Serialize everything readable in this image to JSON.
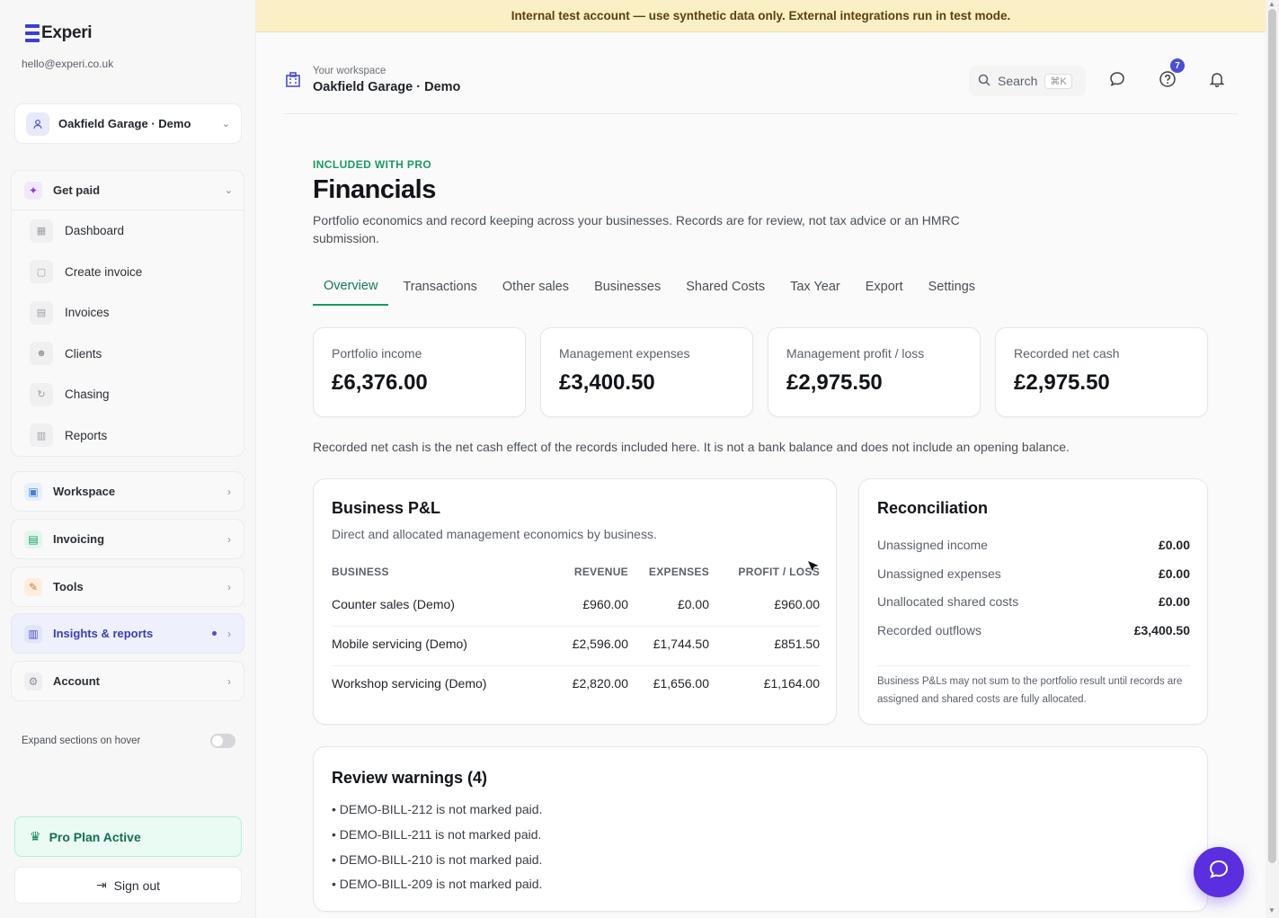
{
  "sidebar": {
    "brand": "Experi",
    "email": "hello@experi.co.uk",
    "workspace_selector": "Oakfield Garage · Demo",
    "get_paid": {
      "label": "Get paid",
      "items": [
        {
          "label": "Dashboard",
          "icon": "grid-icon"
        },
        {
          "label": "Create invoice",
          "icon": "file-plus-icon"
        },
        {
          "label": "Invoices",
          "icon": "file-icon"
        },
        {
          "label": "Clients",
          "icon": "users-icon"
        },
        {
          "label": "Chasing",
          "icon": "refresh-icon"
        },
        {
          "label": "Reports",
          "icon": "bar-chart-icon"
        }
      ]
    },
    "sections": [
      {
        "label": "Workspace",
        "icon": "calendar-icon",
        "color": "#4a80d8"
      },
      {
        "label": "Invoicing",
        "icon": "document-icon",
        "color": "#1a9a62"
      },
      {
        "label": "Tools",
        "icon": "wrench-icon",
        "color": "#e07a1f"
      },
      {
        "label": "Insights & reports",
        "icon": "chart-icon",
        "color": "#4a4fd1"
      },
      {
        "label": "Account",
        "icon": "gear-icon",
        "color": "#8b9097"
      }
    ],
    "expand_on_hover_label": "Expand sections on hover",
    "pro_plan_label": "Pro Plan Active",
    "sign_out_label": "Sign out"
  },
  "banner": "Internal test account — use synthetic data only. External integrations run in test mode.",
  "header": {
    "eyebrow": "Your workspace",
    "title": "Oakfield Garage · Demo",
    "search_label": "Search",
    "search_shortcut": "⌘K",
    "help_badge": "7"
  },
  "page": {
    "eyebrow": "INCLUDED WITH PRO",
    "title": "Financials",
    "description": "Portfolio economics and record keeping across your businesses. Records are for review, not tax advice or an HMRC submission.",
    "tabs": [
      "Overview",
      "Transactions",
      "Other sales",
      "Businesses",
      "Shared Costs",
      "Tax Year",
      "Export",
      "Settings"
    ],
    "active_tab": "Overview",
    "kpis": [
      {
        "label": "Portfolio income",
        "value": "£6,376.00"
      },
      {
        "label": "Management expenses",
        "value": "£3,400.50"
      },
      {
        "label": "Management profit / loss",
        "value": "£2,975.50"
      },
      {
        "label": "Recorded net cash",
        "value": "£2,975.50"
      }
    ],
    "net_cash_note": "Recorded net cash is the net cash effect of the records included here. It is not a bank balance and does not include an opening balance."
  },
  "pnl": {
    "title": "Business P&L",
    "subtitle": "Direct and allocated management economics by business.",
    "headers": {
      "business": "BUSINESS",
      "revenue": "REVENUE",
      "expenses": "EXPENSES",
      "profit": "PROFIT / LOSS"
    },
    "rows": [
      {
        "business": "Counter sales (Demo)",
        "revenue": "£960.00",
        "expenses": "£0.00",
        "profit": "£960.00"
      },
      {
        "business": "Mobile servicing (Demo)",
        "revenue": "£2,596.00",
        "expenses": "£1,744.50",
        "profit": "£851.50"
      },
      {
        "business": "Workshop servicing (Demo)",
        "revenue": "£2,820.00",
        "expenses": "£1,656.00",
        "profit": "£1,164.00"
      }
    ]
  },
  "reconciliation": {
    "title": "Reconciliation",
    "rows": [
      {
        "label": "Unassigned income",
        "value": "£0.00"
      },
      {
        "label": "Unassigned expenses",
        "value": "£0.00"
      },
      {
        "label": "Unallocated shared costs",
        "value": "£0.00"
      },
      {
        "label": "Recorded outflows",
        "value": "£3,400.50"
      }
    ],
    "note": "Business P&Ls may not sum to the portfolio result until records are assigned and shared costs are fully allocated."
  },
  "warnings": {
    "title": "Review warnings (4)",
    "items": [
      "• DEMO-BILL-212 is not marked paid.",
      "• DEMO-BILL-211 is not marked paid.",
      "• DEMO-BILL-210 is not marked paid.",
      "• DEMO-BILL-209 is not marked paid."
    ]
  }
}
